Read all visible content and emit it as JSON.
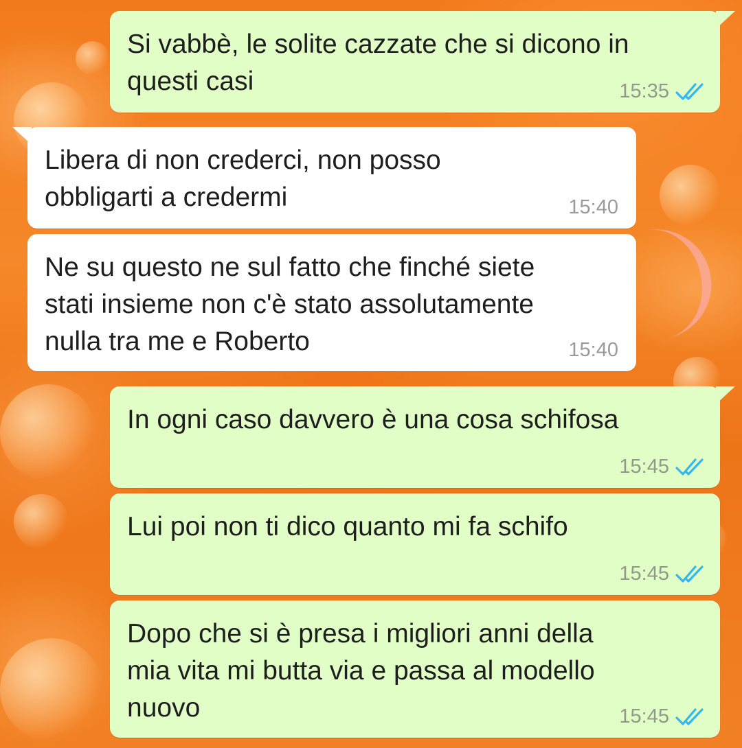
{
  "chat": {
    "messages": [
      {
        "direction": "out",
        "text": "Si vabbè, le solite cazzate che si dicono in\nquesti casi",
        "time": "15:35",
        "status": "read-double-check-icon"
      },
      {
        "direction": "in",
        "text": "Libera di non crederci, non posso\nobbligarti a credermi",
        "time": "15:40"
      },
      {
        "direction": "in",
        "text": "Ne su questo ne sul fatto che finché siete\nstati insieme non c'è stato assolutamente\nnulla tra me e Roberto",
        "time": "15:40"
      },
      {
        "direction": "out",
        "text": "In ogni caso davvero è una cosa schifosa",
        "time": "15:45",
        "status": "read-double-check-icon"
      },
      {
        "direction": "out",
        "text": "Lui poi non ti dico quanto mi fa schifo",
        "time": "15:45",
        "status": "read-double-check-icon"
      },
      {
        "direction": "out",
        "text": "Dopo che si è presa i migliori anni della\nmia vita mi butta via e passa al modello\nnuovo",
        "time": "15:45",
        "status": "read-double-check-icon"
      }
    ]
  },
  "colors": {
    "outgoing_bubble": "#e1fec6",
    "incoming_bubble": "#ffffff",
    "read_ticks": "#34b7f1",
    "wallpaper": "#f37a1c"
  }
}
